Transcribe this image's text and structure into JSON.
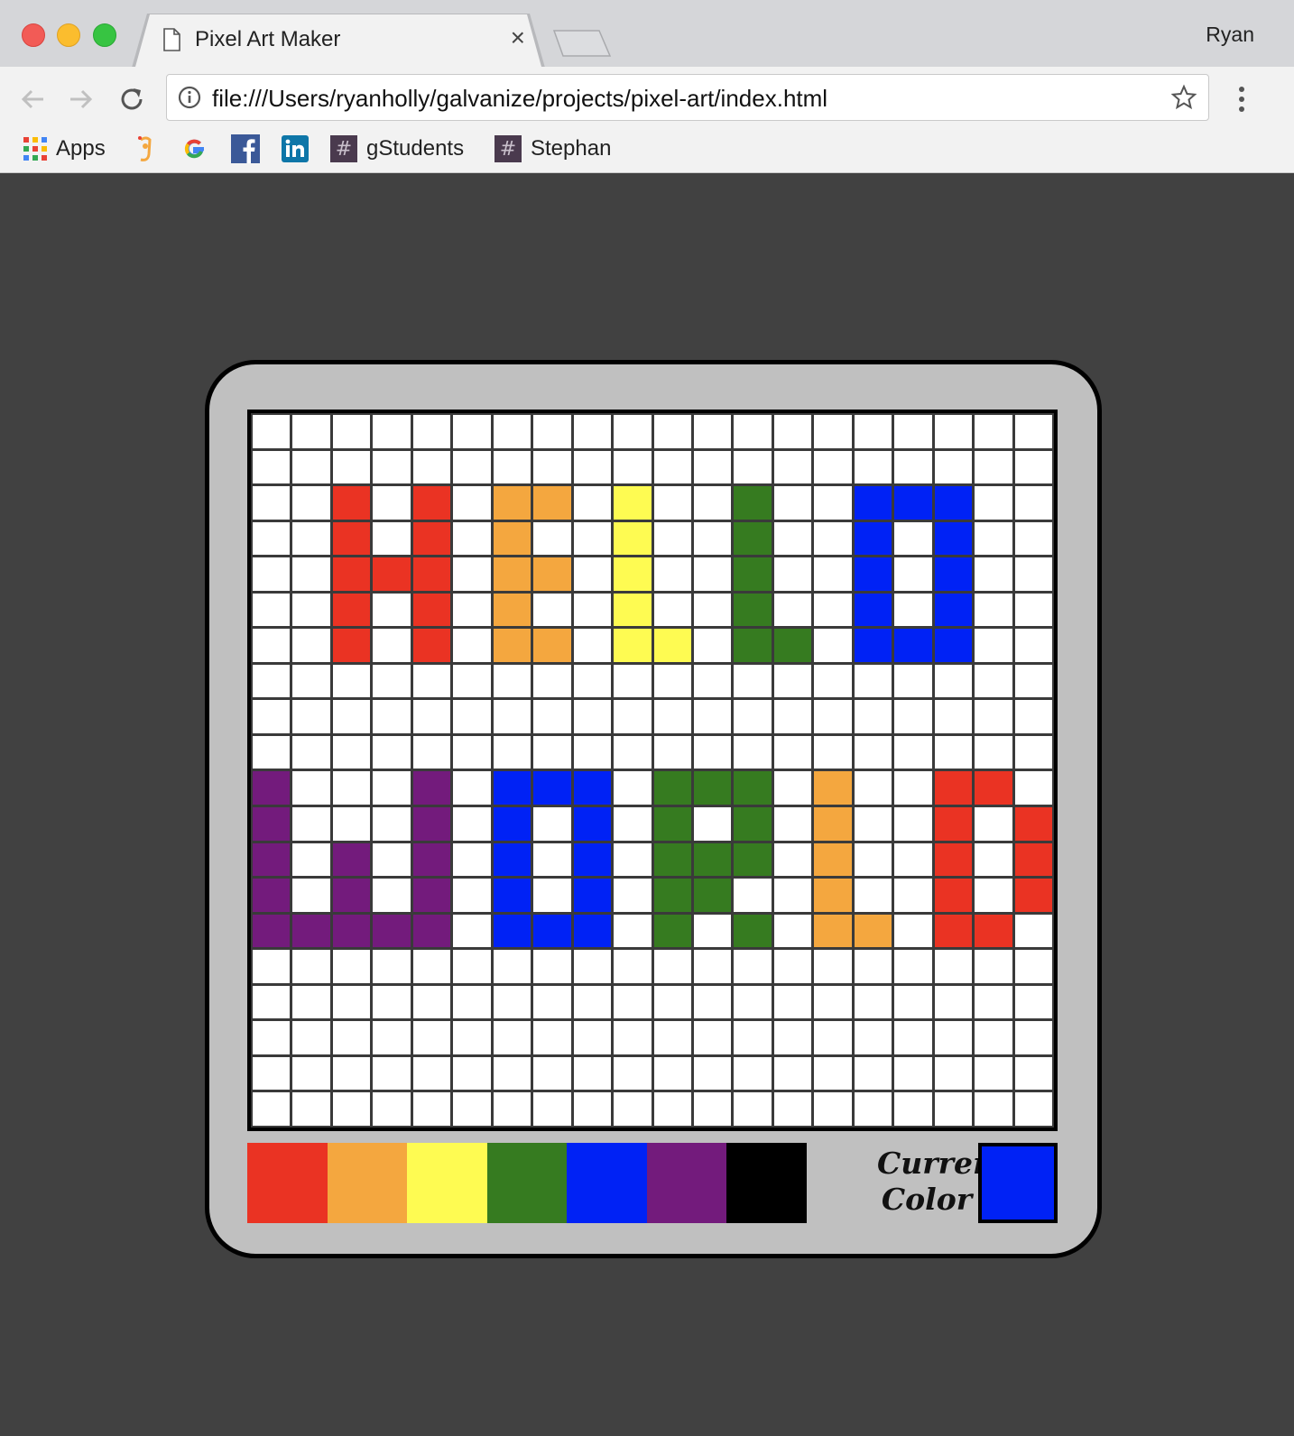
{
  "browser": {
    "tab_title": "Pixel Art Maker",
    "close_glyph": "×",
    "profile_name": "Ryan",
    "url": "file:///Users/ryanholly/galvanize/projects/pixel-art/index.html",
    "bookmarks": [
      {
        "label": "Apps",
        "icon": "apps-grid-icon"
      },
      {
        "label": "",
        "icon": "galvanize-icon"
      },
      {
        "label": "",
        "icon": "google-icon"
      },
      {
        "label": "",
        "icon": "facebook-icon"
      },
      {
        "label": "",
        "icon": "linkedin-icon"
      },
      {
        "label": "gStudents",
        "icon": "slack-icon"
      },
      {
        "label": "Stephan",
        "icon": "slack-icon"
      }
    ]
  },
  "pixel_art": {
    "grid_size": 20,
    "colors": {
      "R": "#ea3323",
      "O": "#f4a73f",
      "Y": "#fefb52",
      "G": "#367b20",
      "B": "#0022f5",
      "P": "#731b7c",
      "K": "#000000",
      "W": "#ffffff"
    },
    "rows": [
      "WWWWWWWWWWWWWWWWWWWW",
      "WWWWWWWWWWWWWWWWWWWW",
      "WWRWRWOOWYWWGWWBBBWW",
      "WWRWRWOWWYWWGWWBWBWW",
      "WWRRRWOOWYWWGWWBWBWW",
      "WWRWRWOWWYWWGWWBWBWW",
      "WWRWRWOOWYYWGGWBBBWW",
      "WWWWWWWWWWWWWWWWWWWW",
      "WWWWWWWWWWWWWWWWWWWW",
      "WWWWWWWWWWWWWWWWWWWW",
      "PWWWPWBBBWGGGWOWWRRW",
      "PWWWPWBWBWGWGWOWWRWR",
      "PWPWPWBWBWGGGWOWWRWR",
      "PWPWPWBWBWGGWWOWWRWR",
      "PPPPPWBBBWGWGWOOWRRW",
      "WWWWWWWWWWWWWWWWWWWW",
      "WWWWWWWWWWWWWWWWWWWW",
      "WWWWWWWWWWWWWWWWWWWW",
      "WWWWWWWWWWWWWWWWWWWW",
      "WWWWWWWWWWWWWWWWWWWW"
    ],
    "palette": [
      {
        "name": "red",
        "color": "#ea3323"
      },
      {
        "name": "orange",
        "color": "#f4a73f"
      },
      {
        "name": "yellow",
        "color": "#fefb52"
      },
      {
        "name": "green",
        "color": "#367b20"
      },
      {
        "name": "blue",
        "color": "#0022f5"
      },
      {
        "name": "purple",
        "color": "#731b7c"
      },
      {
        "name": "black",
        "color": "#000000"
      }
    ],
    "current_label_line1": "Current",
    "current_label_line2": "Color",
    "current_color": "#0022f5"
  }
}
